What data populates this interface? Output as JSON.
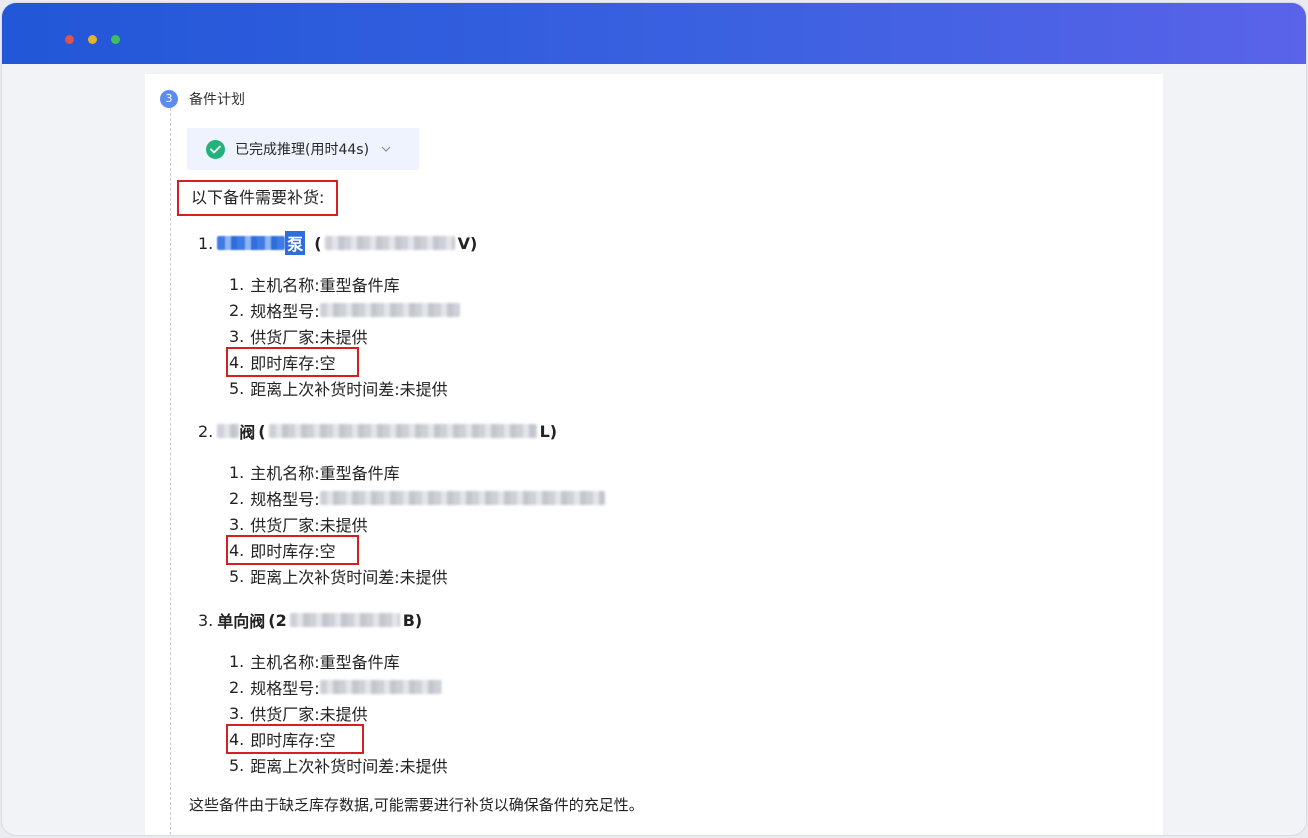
{
  "step": {
    "number": "3",
    "title": "备件计划"
  },
  "status": {
    "text": "已完成推理(用时44s)"
  },
  "intro": "以下备件需要补货:",
  "items": [
    {
      "index": "1.",
      "name_char": "泵",
      "paren_close": "V)",
      "details": [
        {
          "n": "1.",
          "label": "主机名称:",
          "value": "重型备件库"
        },
        {
          "n": "2.",
          "label": "规格型号:",
          "value": ""
        },
        {
          "n": "3.",
          "label": "供货厂家:",
          "value": "未提供"
        },
        {
          "n": "4.",
          "label": "即时库存:",
          "value": "空"
        },
        {
          "n": "5.",
          "label": "距离上次补货时间差:",
          "value": "未提供"
        }
      ]
    },
    {
      "index": "2.",
      "name_char": "阀",
      "paren_close": "L)",
      "details": [
        {
          "n": "1.",
          "label": "主机名称:",
          "value": "重型备件库"
        },
        {
          "n": "2.",
          "label": "规格型号:",
          "value": ""
        },
        {
          "n": "3.",
          "label": "供货厂家:",
          "value": "未提供"
        },
        {
          "n": "4.",
          "label": "即时库存:",
          "value": "空"
        },
        {
          "n": "5.",
          "label": "距离上次补货时间差:",
          "value": "未提供"
        }
      ]
    },
    {
      "index": "3.",
      "name_char": "单向阀",
      "paren_open": "(2",
      "paren_close": "B)",
      "details": [
        {
          "n": "1.",
          "label": "主机名称:",
          "value": "重型备件库"
        },
        {
          "n": "2.",
          "label": "规格型号:",
          "value": ""
        },
        {
          "n": "3.",
          "label": "供货厂家:",
          "value": "未提供"
        },
        {
          "n": "4.",
          "label": "即时库存:",
          "value": "空"
        },
        {
          "n": "5.",
          "label": "距离上次补货时间差:",
          "value": "未提供"
        }
      ]
    }
  ],
  "footer": "这些备件由于缺乏库存数据,可能需要进行补货以确保备件的充足性。",
  "icons": {
    "check": "check-circle-icon",
    "chevron": "chevron-down-icon"
  },
  "colors": {
    "accent": "#2157d8",
    "highlight_border": "#d62020",
    "success": "#23b27a"
  }
}
